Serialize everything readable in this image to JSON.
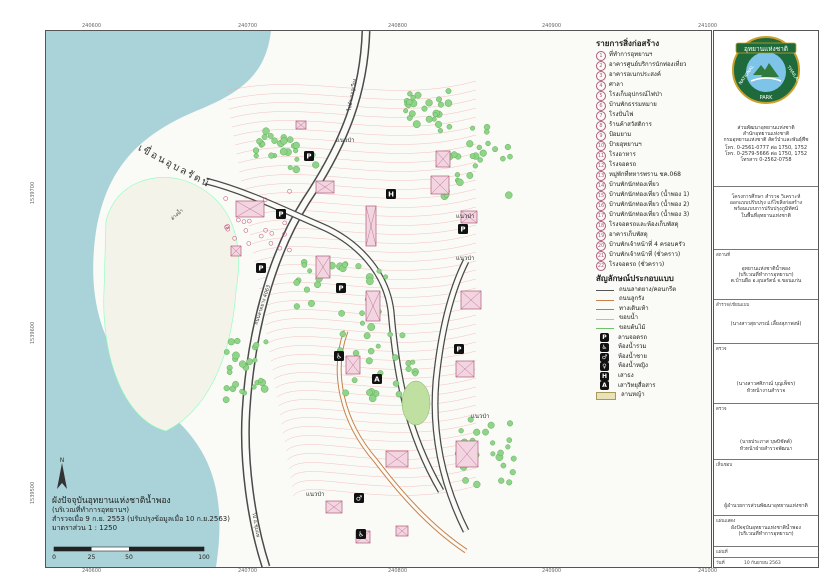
{
  "grid": {
    "top_ticks": [
      "240600",
      "240700",
      "240800",
      "240900",
      "241000"
    ],
    "bottom_ticks": [
      "240600",
      "240700",
      "240800",
      "240900",
      "241000"
    ],
    "left_ticks": [
      "1539700",
      "1539600",
      "1539500"
    ]
  },
  "map_labels": {
    "reservoir": "เขื่อนอุบลรัตน์",
    "forest": "แนวป่า",
    "road_a": "ถนนลาดยาง 4063",
    "road_b": "ไปอำเภอภูเวียง",
    "road_c": "ไป อ.ชุมแพ",
    "island": "อ่างน้ำ"
  },
  "legend": {
    "title": "รายการสิ่งก่อสร้าง",
    "items": [
      {
        "num": "1",
        "label": "ที่ทำการอุทยานฯ"
      },
      {
        "num": "2",
        "label": "อาคารศูนย์บริการนักท่องเที่ยว"
      },
      {
        "num": "3",
        "label": "อาคารอเนกประสงค์"
      },
      {
        "num": "4",
        "label": "ศาลา"
      },
      {
        "num": "5",
        "label": "โรงเก็บอุปกรณ์ไฟป่า"
      },
      {
        "num": "6",
        "label": "บ้านพักธรรมหมาย"
      },
      {
        "num": "7",
        "label": "โรงปั่นไฟ"
      },
      {
        "num": "8",
        "label": "ร้านค้าสวัสดิการ"
      },
      {
        "num": "9",
        "label": "ป้อมยาม"
      },
      {
        "num": "10",
        "label": "ป้ายอุทยานฯ"
      },
      {
        "num": "11",
        "label": "โรงอาหาร"
      },
      {
        "num": "12",
        "label": "โรงจอดรถ"
      },
      {
        "num": "13",
        "label": "หมู่พักที่ทหารพราน ชค.068"
      },
      {
        "num": "14",
        "label": "บ้านพักนักท่องเที่ยว"
      },
      {
        "num": "15",
        "label": "บ้านพักนักท่องเที่ยว (น้ำพอง 1)"
      },
      {
        "num": "16",
        "label": "บ้านพักนักท่องเที่ยว (น้ำพอง 2)"
      },
      {
        "num": "17",
        "label": "บ้านพักนักท่องเที่ยว (น้ำพอง 3)"
      },
      {
        "num": "18",
        "label": "โรงจอดรถและห้องเก็บพัสดุ"
      },
      {
        "num": "19",
        "label": "อาคารเก็บพัสดุ"
      },
      {
        "num": "20",
        "label": "บ้านพักเจ้าหน้าที่ 4 ครอบครัว"
      },
      {
        "num": "21",
        "label": "บ้านพักเจ้าหน้าที่ (ชั่วคราว)"
      },
      {
        "num": "22",
        "label": "โรงจอดรถ (ชั่วคราว)"
      }
    ]
  },
  "symbols": {
    "title": "สัญลักษณ์ประกอบแบบ",
    "lines": [
      {
        "label": "ถนนลาดยาง/คอนกรีต",
        "color": "#555555"
      },
      {
        "label": "ถนนลูกรัง",
        "color": "#c8814a"
      },
      {
        "label": "ทางเดินเท้า",
        "color": "#888888"
      },
      {
        "label": "ขอบน้ำ",
        "color": "#7fd3e0"
      },
      {
        "label": "ขอบต้นไม้",
        "color": "#6fc26a"
      }
    ],
    "icons": [
      {
        "glyph": "P",
        "label": "ลานจอดรถ"
      },
      {
        "glyph": "♿",
        "label": "ห้องน้ำรวม"
      },
      {
        "glyph": "♂",
        "label": "ห้องน้ำชาย"
      },
      {
        "glyph": "♀",
        "label": "ห้องน้ำหญิง"
      },
      {
        "glyph": "H",
        "label": "เสาธง"
      },
      {
        "glyph": "A",
        "label": "เสาวิทยุสื่อสาร"
      }
    ],
    "area_label": "ลานหญ้า"
  },
  "map_title": {
    "line1": "ผังปัจจุบันอุทยานแห่งชาติน้ำพอง",
    "line2": "(บริเวณที่ทำการอุทยานฯ)",
    "line3": "สำรวจเมื่อ 9 ก.ย. 2553  (ปรับปรุงข้อมูลเมื่อ 10 ก.ย.2563)",
    "scale_text": "มาตราส่วน      1 : 1250"
  },
  "scale_ticks": [
    "0",
    "25",
    "50",
    "100"
  ],
  "north_label": "N",
  "title_block": {
    "logo_top": "อุทยานแห่งชาติ",
    "logo_left": "NATIONAL",
    "logo_mid": "PARK",
    "logo_right": "THAILAND",
    "org_lines": [
      "ส่วนพัฒนาอุทยานแห่งชาติ",
      "สำนักอุทยานแห่งชาติ",
      "กรมอุทยานแห่งชาติ สัตว์ป่าและพันธุ์พืช"
    ],
    "phone_lines": [
      "โทร. 0-2561-0777  ต่อ 1750, 1752",
      "โทร. 0-2579-5666  ต่อ 1750, 1752",
      "โทรสาร  0-2562-0758"
    ],
    "project_lines": [
      "โครงการศึกษา สำรวจ วิเคราะห์",
      "ออกแบบปรับปรุง แก้ไขสิ่งก่อสร้าง",
      "พร้อมแบบการปรับปรุงภูมิทัศน์",
      "ในพื้นที่อุทยานแห่งชาติ"
    ],
    "place_label": "สถานที่",
    "place_lines": [
      "อุทยานแห่งชาติน้ำพอง",
      "(บริเวณที่ทำการอุทยานฯ)",
      "ต.บ้านผือ อ.อุบลรัตน์ จ.ขอนแก่น"
    ],
    "surveyor_label": "สำรวจ/เขียนแบบ",
    "surveyor_name": "(นางสาวสุธาภรณ์ เลี้ยงสุภาพงษ์)",
    "check_label": "ตรวจ",
    "check_name": "(นางสาวศศิภาณ์ บุญเพ็ชร)",
    "check_role": "หัวหน้างานสำรวจ",
    "check2_label": "ตรวจ",
    "check2_name": "(นายประภาส บุษบิชัตต์)",
    "check2_role": "หัวหน้าฝ่ายสำรวจพัฒนา",
    "approve_label": "เห็นชอบ",
    "approve_role": "ผู้อำนวยการส่วนพัฒนาอุทยานแห่งชาติ",
    "sheet_label": "แผ่นแสดง",
    "sheet_lines": [
      "ผังปัจจุบันอุทยานแห่งชาติน้ำพอง",
      "(บริเวณที่ทำการอุทยานฯ)"
    ],
    "sheet_no_label": "แผ่นที่",
    "date_label": "วันที่",
    "date_value": "10 กันยายน 2563"
  },
  "colors": {
    "water": "#a9d3d8",
    "tree": "#6fc26a",
    "building": "#b05a7c",
    "paved": "#4a4a4a",
    "laterite": "#c8814a"
  }
}
